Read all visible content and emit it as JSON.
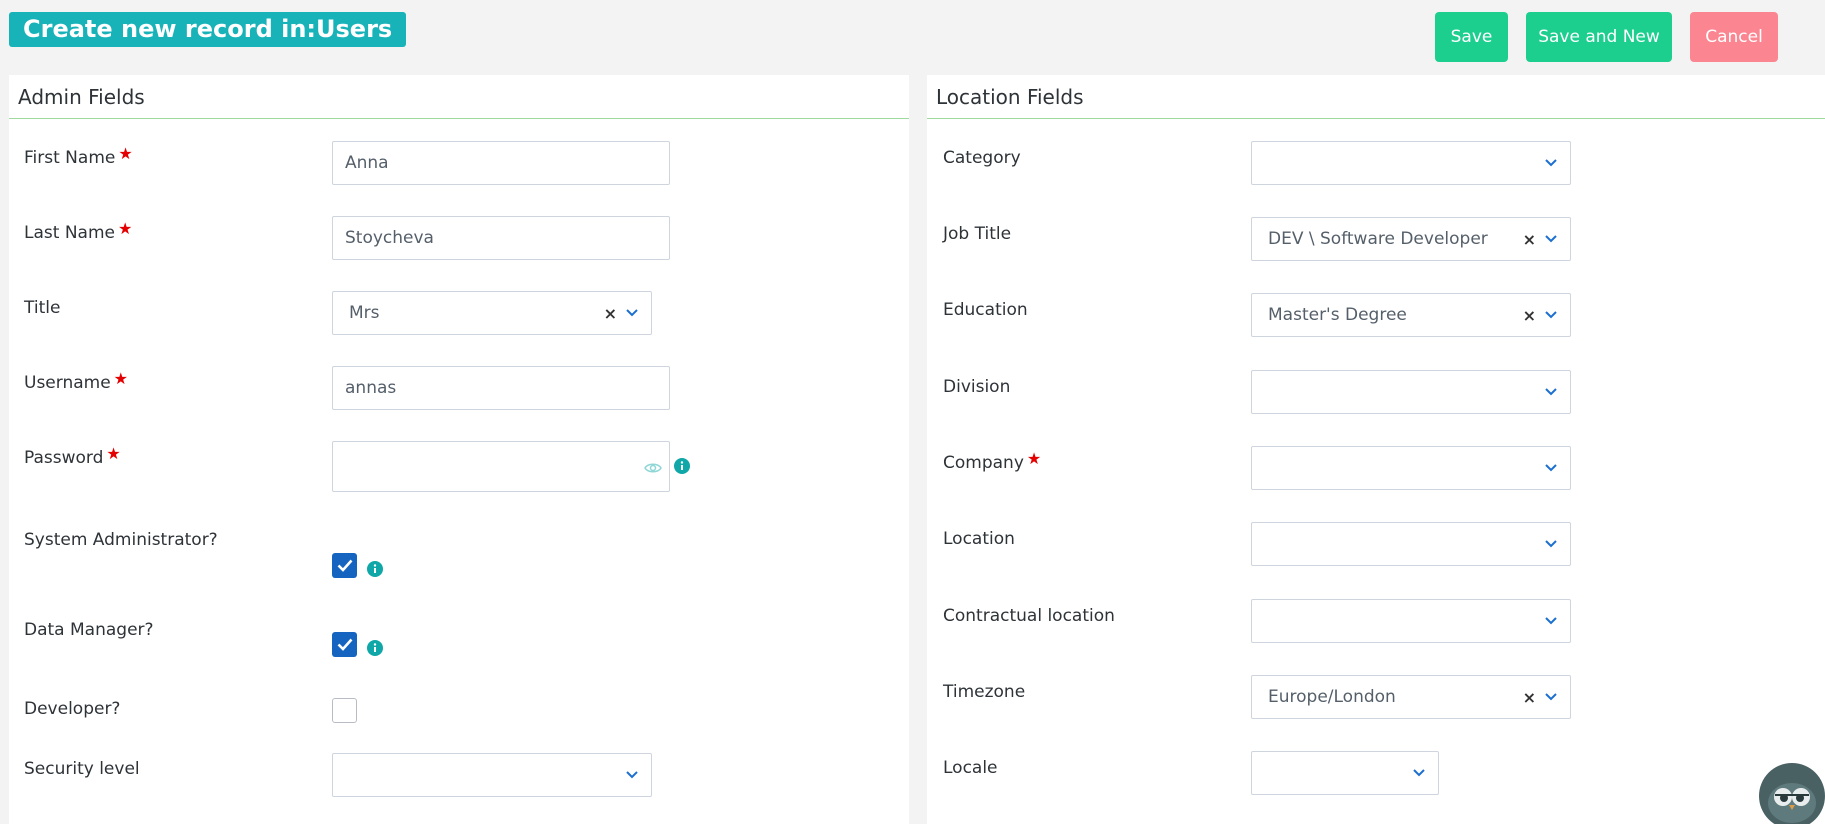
{
  "header": {
    "title": "Create new record in:Users",
    "buttons": {
      "save": "Save",
      "save_and_new": "Save and New",
      "cancel": "Cancel"
    }
  },
  "admin": {
    "heading": "Admin Fields",
    "fields": {
      "first_name": {
        "label": "First Name",
        "value": "Anna"
      },
      "last_name": {
        "label": "Last Name",
        "value": "Stoycheva"
      },
      "title": {
        "label": "Title",
        "value": "Mrs"
      },
      "username": {
        "label": "Username",
        "value": "annas"
      },
      "password": {
        "label": "Password",
        "value": ""
      },
      "system_admin": {
        "label": "System Administrator?",
        "checked": true
      },
      "data_manager": {
        "label": "Data Manager?",
        "checked": true
      },
      "developer": {
        "label": "Developer?",
        "checked": false
      },
      "security_level": {
        "label": "Security level",
        "value": ""
      }
    }
  },
  "location": {
    "heading": "Location Fields",
    "fields": {
      "category": {
        "label": "Category",
        "value": ""
      },
      "job_title": {
        "label": "Job Title",
        "value": "DEV \\ Software Developer"
      },
      "education": {
        "label": "Education",
        "value": "Master's Degree"
      },
      "division": {
        "label": "Division",
        "value": ""
      },
      "company": {
        "label": "Company",
        "value": ""
      },
      "location": {
        "label": "Location",
        "value": ""
      },
      "contractual_location": {
        "label": "Contractual location",
        "value": ""
      },
      "timezone": {
        "label": "Timezone",
        "value": "Europe/London"
      },
      "locale": {
        "label": "Locale",
        "value": ""
      }
    }
  },
  "icons": {
    "required": "star-icon",
    "clear": "close-icon",
    "dropdown": "chevron-down-icon",
    "info": "info-icon",
    "show_password": "eye-icon",
    "check": "check-icon",
    "assistant": "owl-avatar"
  },
  "colors": {
    "brand_teal": "#17b3b8",
    "save_green": "#1ccf8f",
    "cancel_pink": "#fb8591",
    "required_red": "#e40000",
    "checkbox_blue": "#1565c0",
    "info_teal": "#0fa7a7"
  }
}
